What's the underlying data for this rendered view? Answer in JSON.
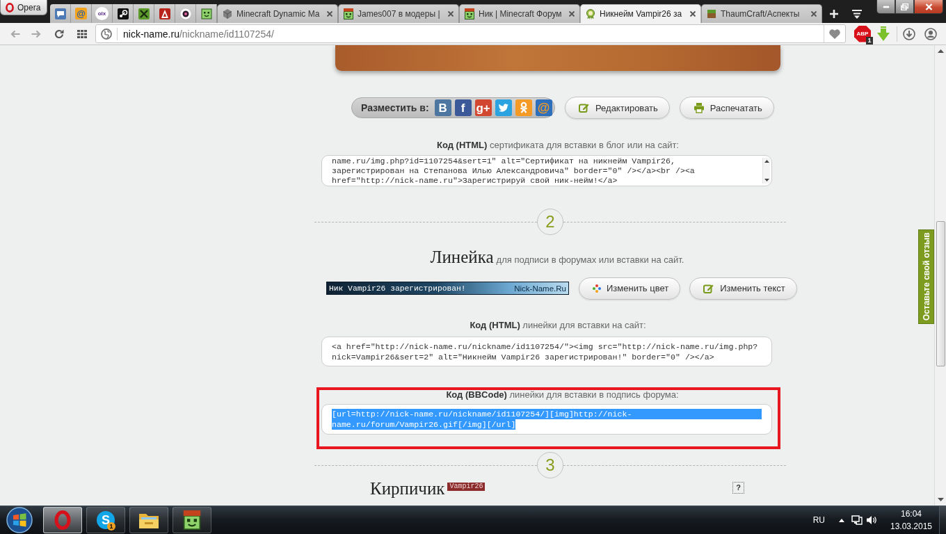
{
  "browser": {
    "opera_button": "Opera",
    "pinned_tabs": [
      {
        "kind": "bubble"
      },
      {
        "kind": "at-tile",
        "glyph": "@"
      },
      {
        "kind": "text-disc",
        "glyph": "olx"
      },
      {
        "kind": "rings"
      },
      {
        "kind": "swords"
      },
      {
        "kind": "tower"
      },
      {
        "kind": "eye"
      },
      {
        "kind": "face"
      }
    ],
    "tabs": [
      {
        "kind": "cube",
        "title": "Minecraft Dynamic Ma",
        "selected": false
      },
      {
        "kind": "hat-face",
        "title": "James007 в модеры |",
        "selected": false
      },
      {
        "kind": "hat-face",
        "title": "Ник | Minecraft Форум",
        "selected": false
      },
      {
        "kind": "rosette",
        "title": "Никнейм Vampir26 за",
        "selected": true
      },
      {
        "kind": "grass",
        "title": "ThaumCraft/Аспекты",
        "selected": false
      }
    ],
    "address": {
      "host": "nick-name.ru",
      "path": "/nickname/id1107254/"
    },
    "adblock": {
      "label": "ABP",
      "count": "1"
    }
  },
  "page": {
    "share": {
      "label": "Разместить в:",
      "networks": [
        {
          "kind": "glyph",
          "glyph": "В",
          "color": "#4d76a1"
        },
        {
          "kind": "glyph",
          "glyph": "f",
          "color": "#3b5998"
        },
        {
          "kind": "glyph",
          "glyph": "g+",
          "color": "#d2472f"
        },
        {
          "kind": "bird",
          "color": "#2aa3e0"
        },
        {
          "kind": "figure",
          "color": "#f59a25"
        },
        {
          "kind": "ring-glyph",
          "glyph": "@",
          "color": "#2d6fbb"
        }
      ]
    },
    "actions": [
      {
        "kind": "edit",
        "label": "Редактировать"
      },
      {
        "kind": "print",
        "label": "Распечатать"
      }
    ],
    "certificate_code": {
      "label": "**Код (HTML)** сертификата для вставки в блог или на сайт:",
      "lines": [
        "name.ru/img.php?id=1107254&sert=1\" alt=\"Сертификат на никнейм Vampir26,",
        "зарегистрирован на Степанова Илью Александровича\" border=\"0\" /></a><br /><a",
        "href=\"http://nick-name.ru\">Зарегистрируй свой ник-нейм!</a>"
      ]
    },
    "sections": [
      {
        "number": "2",
        "title": "Линейка",
        "subtitle": "для подписи в форумах или вставки на сайт.",
        "userbar": {
          "text": "Ник Vampir26 зарегистрирован!",
          "brand": "Nick-Name.Ru"
        },
        "buttons": [
          {
            "kind": "palette",
            "label": "Изменить цвет"
          },
          {
            "kind": "edit",
            "label": "Изменить текст"
          }
        ],
        "codes": [
          {
            "label": "**Код (HTML)** линейки для вставки на сайт:",
            "lines": [
              "<a href=\"http://nick-name.ru/nickname/id1107254/\"><img src=\"http://nick-name.ru/img.php?",
              "nick=Vampir26&sert=2\" alt=\"Никнейм Vampir26 зарегистрирован!\" border=\"0\" /></a>"
            ],
            "highlighted": false,
            "text_selected": false
          },
          {
            "label": "**Код (BBCode)** линейки для вставки в подпись форума:",
            "lines": [
              "[url=http://nick-name.ru/nickname/id1107254/][img]http://nick-",
              "name.ru/forum/Vampir26.gif[/img][/url]"
            ],
            "highlighted": true,
            "text_selected": true
          }
        ]
      },
      {
        "number": "3",
        "title": "Кирпичик",
        "badge": "Vampir26",
        "help": "?"
      }
    ]
  },
  "feedback_tab": "Оставьте свой отзыв",
  "taskbar": {
    "apps": [
      {
        "kind": "o-ring",
        "selected": true
      },
      {
        "kind": "s-disc",
        "glyph": "S",
        "badge": "1",
        "selected": false
      },
      {
        "kind": "folder",
        "selected": false
      },
      {
        "kind": "hat-face",
        "selected": false
      }
    ],
    "language": "RU",
    "time": "16:04",
    "date": "13.03.2015"
  }
}
